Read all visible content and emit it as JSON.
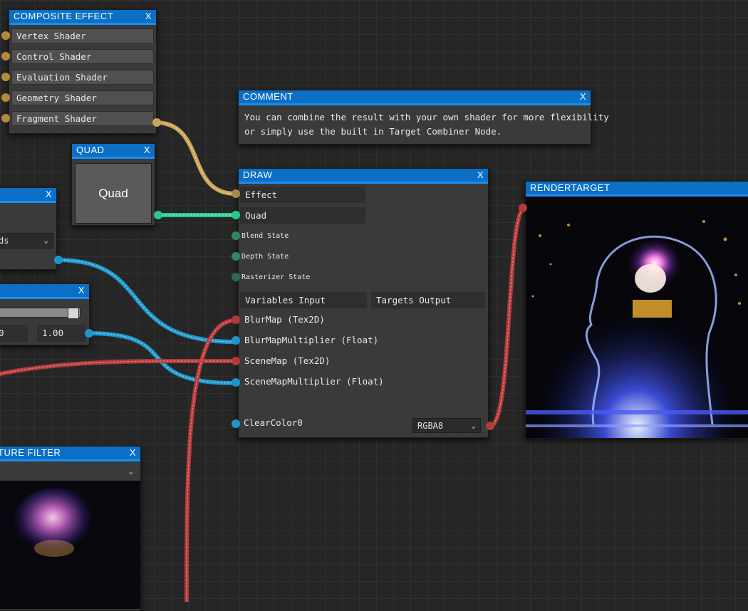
{
  "composite": {
    "title": "COMPOSITE EFFECT",
    "close": "X",
    "items": [
      "Vertex Shader",
      "Control Shader",
      "Evaluation Shader",
      "Geometry Shader",
      "Fragment Shader"
    ]
  },
  "comment": {
    "title": "COMMENT",
    "close": "X",
    "line1": "You can combine the result with your own shader for more flexibility",
    "line2": "or simply use the built in Target Combiner Node."
  },
  "quad": {
    "title": "QUAD",
    "close": "X",
    "preview": "Quad"
  },
  "leftnode1": {
    "close": "X",
    "select_value": "ds"
  },
  "slidernode": {
    "close": "X",
    "value_left": "0",
    "value_right": "1.00"
  },
  "draw": {
    "title": "DRAW",
    "close": "X",
    "effect": "Effect",
    "quad": "Quad",
    "blend_state": "Blend State",
    "depth_state": "Depth State",
    "rasterizer_state": "Rasterizer State",
    "variables_input": "Variables Input",
    "targets_output": "Targets Output",
    "inputs": [
      "BlurMap (Tex2D)",
      "BlurMapMultiplier (Float)",
      "SceneMap (Tex2D)",
      "SceneMapMultiplier (Float)"
    ],
    "clear_color": "ClearColor0",
    "format": "RGBA8"
  },
  "rendertarget": {
    "title": "RENDERTARGET"
  },
  "texfilter": {
    "title": "TURE FILTER",
    "close": "X"
  },
  "colors": {
    "header": "#0b6fc6",
    "wire_effect": "#c9a45a",
    "wire_quad": "#25c98a",
    "wire_float": "#1f96c8",
    "wire_tex": "#b23a3a"
  }
}
